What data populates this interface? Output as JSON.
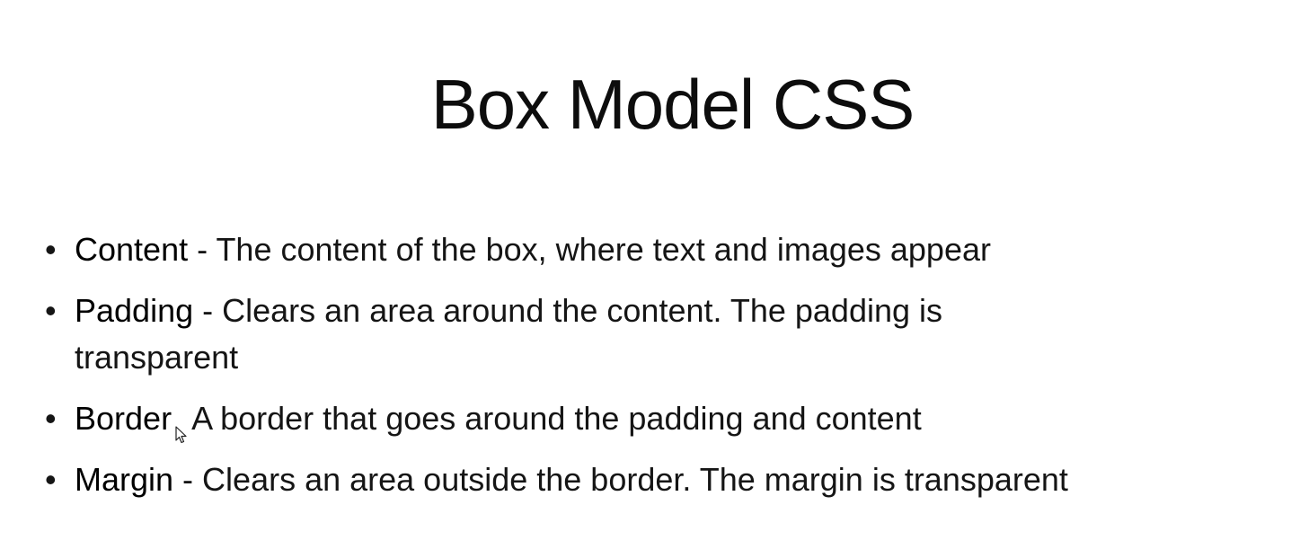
{
  "slide": {
    "title": "Box Model CSS",
    "items": [
      {
        "term": "Content",
        "separator": " - ",
        "text": "The content of the box, where text and images appear"
      },
      {
        "term": "Padding",
        "separator": " - ",
        "text": "Clears an area around the content. The padding is transparent"
      },
      {
        "term": "Border",
        "separator": "",
        "text": "A border that goes around the padding and content"
      },
      {
        "term": "Margin",
        "separator": " - ",
        "text": "Clears an area outside the border. The margin is transparent"
      }
    ],
    "bullet_glyph": "•",
    "overlay_icon": "mouse-pointer-icon"
  }
}
